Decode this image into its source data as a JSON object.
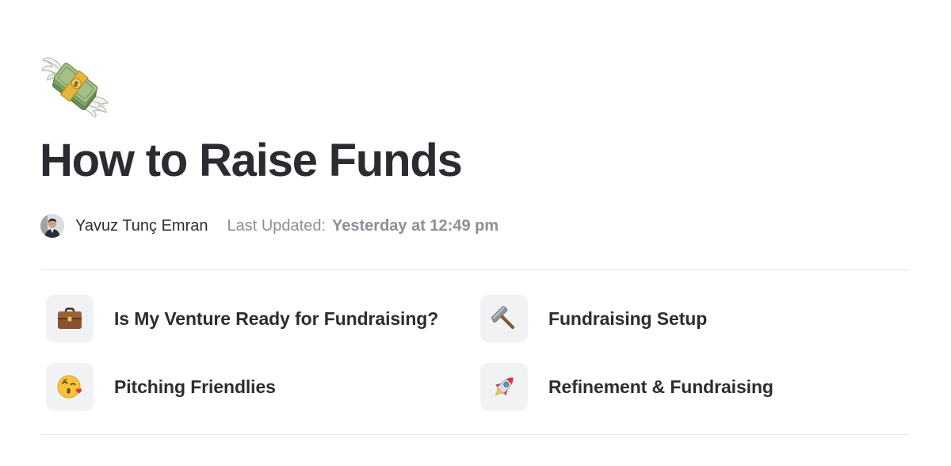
{
  "page": {
    "icon": "money-with-wings-icon",
    "title": "How to Raise Funds"
  },
  "meta": {
    "author_name": "Yavuz Tunç Emran",
    "updated_label": "Last Updated:",
    "updated_value": "Yesterday at 12:49 pm"
  },
  "cards": [
    {
      "label": "Is My Venture Ready for Fundraising?",
      "icon": "briefcase-icon"
    },
    {
      "label": "Fundraising Setup",
      "icon": "hammer-icon"
    },
    {
      "label": "Pitching Friendlies",
      "icon": "kissing-face-icon"
    },
    {
      "label": "Refinement & Fundraising",
      "icon": "rocket-icon"
    }
  ],
  "colors": {
    "title": "#2a2c31",
    "muted_text": "#8a8f99",
    "icon_box_bg": "#f1f2f4",
    "divider": "#e4e5e8"
  }
}
